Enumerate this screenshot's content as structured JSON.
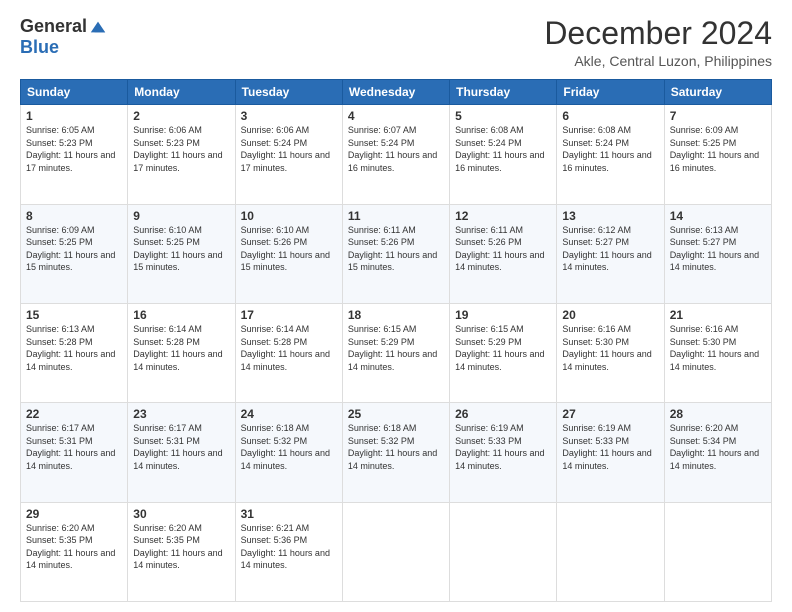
{
  "logo": {
    "general": "General",
    "blue": "Blue"
  },
  "title": "December 2024",
  "location": "Akle, Central Luzon, Philippines",
  "days_of_week": [
    "Sunday",
    "Monday",
    "Tuesday",
    "Wednesday",
    "Thursday",
    "Friday",
    "Saturday"
  ],
  "weeks": [
    [
      {
        "day": "1",
        "sunrise": "6:05 AM",
        "sunset": "5:23 PM",
        "daylight": "11 hours and 17 minutes."
      },
      {
        "day": "2",
        "sunrise": "6:06 AM",
        "sunset": "5:23 PM",
        "daylight": "11 hours and 17 minutes."
      },
      {
        "day": "3",
        "sunrise": "6:06 AM",
        "sunset": "5:24 PM",
        "daylight": "11 hours and 17 minutes."
      },
      {
        "day": "4",
        "sunrise": "6:07 AM",
        "sunset": "5:24 PM",
        "daylight": "11 hours and 16 minutes."
      },
      {
        "day": "5",
        "sunrise": "6:08 AM",
        "sunset": "5:24 PM",
        "daylight": "11 hours and 16 minutes."
      },
      {
        "day": "6",
        "sunrise": "6:08 AM",
        "sunset": "5:24 PM",
        "daylight": "11 hours and 16 minutes."
      },
      {
        "day": "7",
        "sunrise": "6:09 AM",
        "sunset": "5:25 PM",
        "daylight": "11 hours and 16 minutes."
      }
    ],
    [
      {
        "day": "8",
        "sunrise": "6:09 AM",
        "sunset": "5:25 PM",
        "daylight": "11 hours and 15 minutes."
      },
      {
        "day": "9",
        "sunrise": "6:10 AM",
        "sunset": "5:25 PM",
        "daylight": "11 hours and 15 minutes."
      },
      {
        "day": "10",
        "sunrise": "6:10 AM",
        "sunset": "5:26 PM",
        "daylight": "11 hours and 15 minutes."
      },
      {
        "day": "11",
        "sunrise": "6:11 AM",
        "sunset": "5:26 PM",
        "daylight": "11 hours and 15 minutes."
      },
      {
        "day": "12",
        "sunrise": "6:11 AM",
        "sunset": "5:26 PM",
        "daylight": "11 hours and 14 minutes."
      },
      {
        "day": "13",
        "sunrise": "6:12 AM",
        "sunset": "5:27 PM",
        "daylight": "11 hours and 14 minutes."
      },
      {
        "day": "14",
        "sunrise": "6:13 AM",
        "sunset": "5:27 PM",
        "daylight": "11 hours and 14 minutes."
      }
    ],
    [
      {
        "day": "15",
        "sunrise": "6:13 AM",
        "sunset": "5:28 PM",
        "daylight": "11 hours and 14 minutes."
      },
      {
        "day": "16",
        "sunrise": "6:14 AM",
        "sunset": "5:28 PM",
        "daylight": "11 hours and 14 minutes."
      },
      {
        "day": "17",
        "sunrise": "6:14 AM",
        "sunset": "5:28 PM",
        "daylight": "11 hours and 14 minutes."
      },
      {
        "day": "18",
        "sunrise": "6:15 AM",
        "sunset": "5:29 PM",
        "daylight": "11 hours and 14 minutes."
      },
      {
        "day": "19",
        "sunrise": "6:15 AM",
        "sunset": "5:29 PM",
        "daylight": "11 hours and 14 minutes."
      },
      {
        "day": "20",
        "sunrise": "6:16 AM",
        "sunset": "5:30 PM",
        "daylight": "11 hours and 14 minutes."
      },
      {
        "day": "21",
        "sunrise": "6:16 AM",
        "sunset": "5:30 PM",
        "daylight": "11 hours and 14 minutes."
      }
    ],
    [
      {
        "day": "22",
        "sunrise": "6:17 AM",
        "sunset": "5:31 PM",
        "daylight": "11 hours and 14 minutes."
      },
      {
        "day": "23",
        "sunrise": "6:17 AM",
        "sunset": "5:31 PM",
        "daylight": "11 hours and 14 minutes."
      },
      {
        "day": "24",
        "sunrise": "6:18 AM",
        "sunset": "5:32 PM",
        "daylight": "11 hours and 14 minutes."
      },
      {
        "day": "25",
        "sunrise": "6:18 AM",
        "sunset": "5:32 PM",
        "daylight": "11 hours and 14 minutes."
      },
      {
        "day": "26",
        "sunrise": "6:19 AM",
        "sunset": "5:33 PM",
        "daylight": "11 hours and 14 minutes."
      },
      {
        "day": "27",
        "sunrise": "6:19 AM",
        "sunset": "5:33 PM",
        "daylight": "11 hours and 14 minutes."
      },
      {
        "day": "28",
        "sunrise": "6:20 AM",
        "sunset": "5:34 PM",
        "daylight": "11 hours and 14 minutes."
      }
    ],
    [
      {
        "day": "29",
        "sunrise": "6:20 AM",
        "sunset": "5:35 PM",
        "daylight": "11 hours and 14 minutes."
      },
      {
        "day": "30",
        "sunrise": "6:20 AM",
        "sunset": "5:35 PM",
        "daylight": "11 hours and 14 minutes."
      },
      {
        "day": "31",
        "sunrise": "6:21 AM",
        "sunset": "5:36 PM",
        "daylight": "11 hours and 14 minutes."
      },
      null,
      null,
      null,
      null
    ]
  ],
  "labels": {
    "sunrise": "Sunrise:",
    "sunset": "Sunset:",
    "daylight": "Daylight:"
  }
}
